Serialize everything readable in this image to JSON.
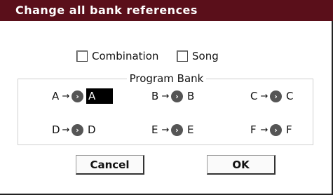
{
  "dialog": {
    "title": "Change all bank references",
    "title_bar_color": "#5a0f1a"
  },
  "options": [
    {
      "label": "Combination",
      "checked": false
    },
    {
      "label": "Song",
      "checked": false
    }
  ],
  "program_bank": {
    "label": "Program Bank",
    "arrow": "→",
    "knob_icon": "›",
    "rows": [
      [
        {
          "from": "A",
          "to": "A",
          "selected": true
        },
        {
          "from": "B",
          "to": "B",
          "selected": false
        },
        {
          "from": "C",
          "to": "C",
          "selected": false
        }
      ],
      [
        {
          "from": "D",
          "to": "D",
          "selected": false
        },
        {
          "from": "E",
          "to": "E",
          "selected": false
        },
        {
          "from": "F",
          "to": "F",
          "selected": false
        }
      ]
    ]
  },
  "buttons": {
    "cancel": "Cancel",
    "ok": "OK"
  }
}
